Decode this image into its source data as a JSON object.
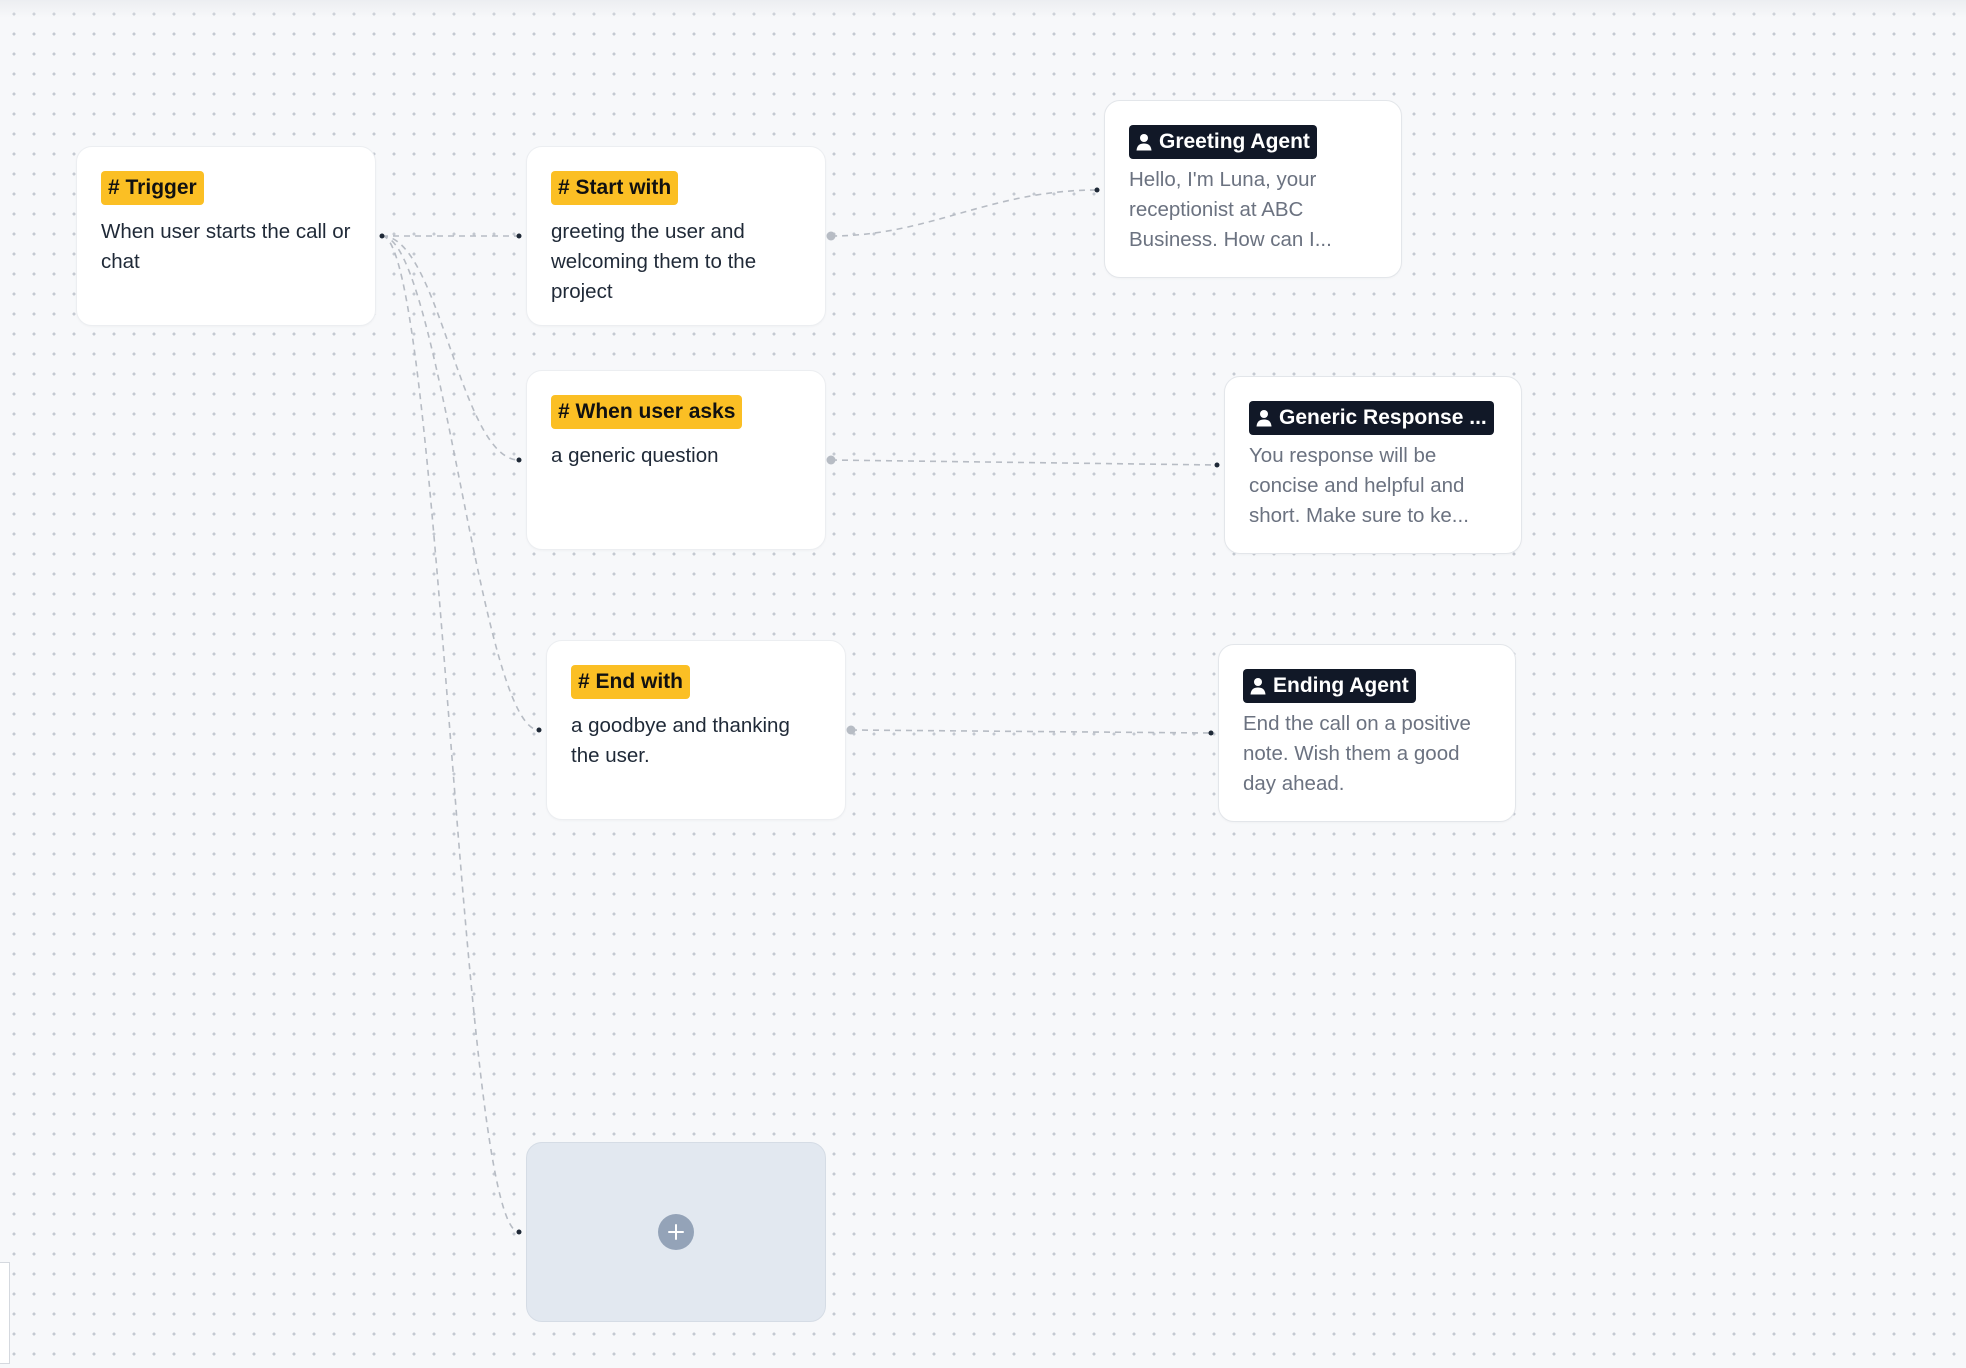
{
  "nodes": {
    "trigger": {
      "tag": "# Trigger",
      "text": "When user starts the call or chat"
    },
    "start": {
      "tag": "# Start with",
      "text": "greeting the user and welcoming them to the project"
    },
    "generic": {
      "tag": "# When user asks",
      "text": "a generic question"
    },
    "end": {
      "tag": "# End with",
      "text": "a goodbye and thanking the user."
    }
  },
  "agents": {
    "greeting": {
      "name": "Greeting Agent",
      "text": "Hello, I'm Luna, your receptionist at ABC Business. How can I..."
    },
    "generic": {
      "name": "Generic Response ...",
      "text": "You response will be concise and helpful and short. Make sure to ke..."
    },
    "ending": {
      "name": "Ending Agent",
      "text": "End the call on a positive note. Wish them a good day ahead."
    }
  },
  "icons": {
    "agent": "user-icon",
    "add": "plus-icon"
  },
  "colors": {
    "tag_bg": "#fbbf24",
    "agent_tag_bg": "#111827",
    "add_node_bg": "#e2e8f0",
    "plus_bg": "#94a3b8"
  }
}
